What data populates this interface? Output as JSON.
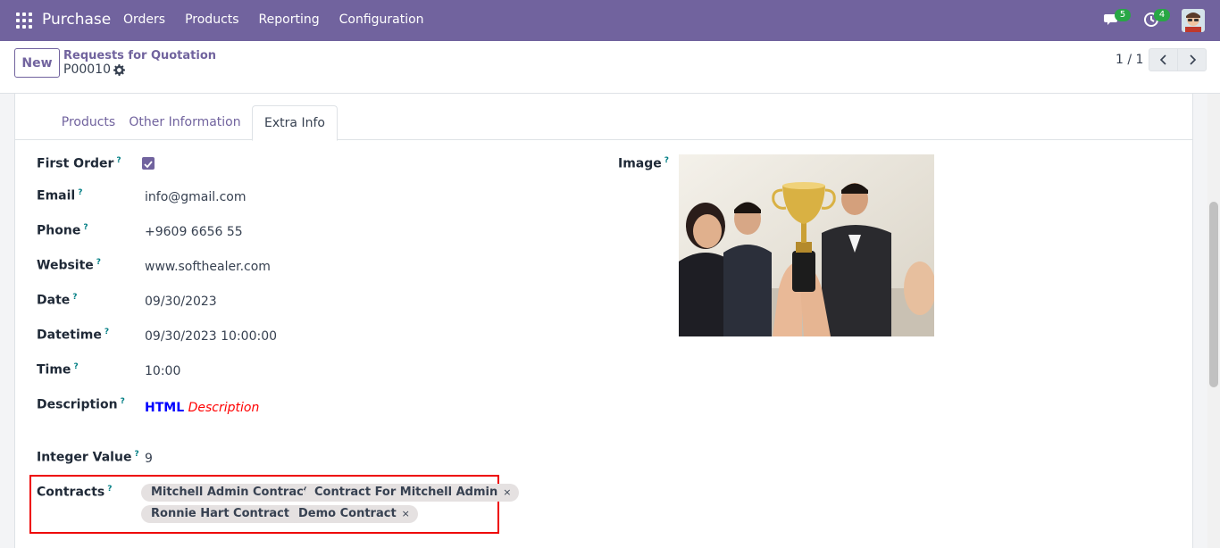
{
  "navbar": {
    "app_name": "Purchase",
    "menu": [
      "Orders",
      "Products",
      "Reporting",
      "Configuration"
    ],
    "messages_count": "5",
    "activities_count": "4",
    "bg_color": "#71639e"
  },
  "control_panel": {
    "new_label": "New",
    "breadcrumb": "Requests for Quotation",
    "record_name": "P00010",
    "pager": "1 / 1"
  },
  "tabs": [
    "Products",
    "Other Information",
    "Extra Info"
  ],
  "fields": {
    "first_order": {
      "label": "First Order",
      "checked": true
    },
    "email": {
      "label": "Email",
      "value": "info@gmail.com"
    },
    "phone": {
      "label": "Phone",
      "value": "+9609 6656 55"
    },
    "website": {
      "label": "Website",
      "value": "www.softhealer.com"
    },
    "date": {
      "label": "Date",
      "value": "09/30/2023"
    },
    "datetime": {
      "label": "Datetime",
      "value": "09/30/2023 10:00:00"
    },
    "time": {
      "label": "Time",
      "value": "10:00"
    },
    "description": {
      "label": "Description",
      "bold": "HTML",
      "italic": "Description"
    },
    "integer": {
      "label": "Integer Value",
      "value": "9"
    },
    "contracts": {
      "label": "Contracts",
      "tags": [
        "Mitchell Admin Contract",
        "Contract For Mitchell Admin",
        "Ronnie Hart Contract",
        "Demo Contract"
      ]
    },
    "image": {
      "label": "Image"
    }
  },
  "help_mark": "?",
  "tag_remove": "×"
}
